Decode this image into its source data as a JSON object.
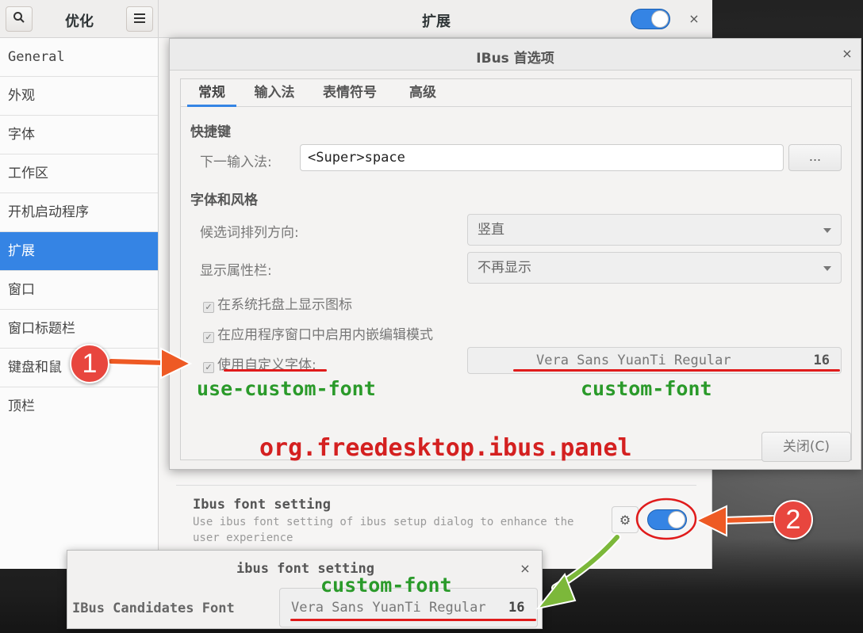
{
  "tweaks": {
    "sidebar_title": "优化",
    "main_title": "扩展",
    "sidebar_items": [
      "General",
      "外观",
      "字体",
      "工作区",
      "开机启动程序",
      "扩展",
      "窗口",
      "窗口标题栏",
      "键盘和鼠",
      "顶栏"
    ],
    "extension": {
      "name": "Ibus font setting",
      "description": "Use ibus font setting of ibus setup dialog to enhance the user experience",
      "enabled": true
    }
  },
  "ibus_prefs": {
    "title": "IBus 首选项",
    "tabs": [
      "常规",
      "输入法",
      "表情符号",
      "高级"
    ],
    "shortcut_section": "快捷键",
    "next_input_label": "下一输入法:",
    "next_input_value": "<Super>space",
    "more_button": "...",
    "font_section": "字体和风格",
    "orientation_label": "候选词排列方向:",
    "orientation_value": "竖直",
    "panel_label": "显示属性栏:",
    "panel_value": "不再显示",
    "check_tray": "在系统托盘上显示图标",
    "check_embedded": "在应用程序窗口中启用内嵌编辑模式",
    "check_custom_font": "使用自定义字体:",
    "font_name": "Vera Sans YuanTi Regular",
    "font_size": "16",
    "close_button": "关闭(C)"
  },
  "font_dialog": {
    "title": "ibus font setting",
    "label": "IBus Candidates Font",
    "font_name": "Vera Sans YuanTi Regular",
    "font_size": "16"
  },
  "annotations": {
    "use_custom_font": "use-custom-font",
    "custom_font": "custom-font",
    "custom_font_2": "custom-font",
    "schema": "org.freedesktop.ibus.panel",
    "badge1": "1",
    "badge2": "2"
  },
  "colors": {
    "accent": "#3584e4",
    "annotation_green": "#2a9a2a",
    "annotation_red": "#d42020",
    "arrow_orange": "#ee5a24",
    "arrow_green": "#7cb83a"
  }
}
